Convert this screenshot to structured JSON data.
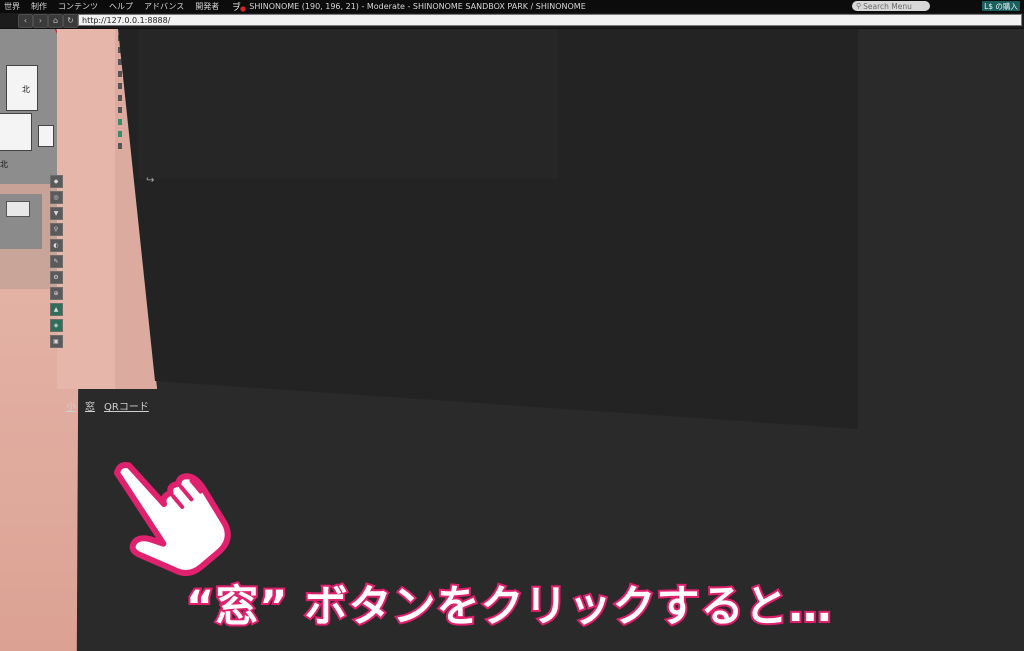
{
  "menubar": {
    "items": [
      "世界",
      "制作",
      "コンテンツ",
      "ヘルプ",
      "アドバンス",
      "開発者"
    ],
    "region": "SHINONOME (190, 196, 21) - Moderate - SHINONOME SANDBOX PARK / SHINONOME",
    "search_placeholder": "Search Menu",
    "buy_label": "L$ の購入",
    "search_icon": "magnifier-icon"
  },
  "navbar": {
    "url": "http://127.0.0.1:8888/",
    "icons": [
      "back-icon",
      "forward-icon",
      "home-icon",
      "reload-icon"
    ]
  },
  "minimap": {
    "labels": [
      "北",
      "北"
    ]
  },
  "panel_links": {
    "small": "小",
    "window": "窓",
    "qr": "QRコード"
  },
  "overlay": {
    "caption": "“窓” ボタンをクリックすると…",
    "caption_color": "#e0226e"
  }
}
